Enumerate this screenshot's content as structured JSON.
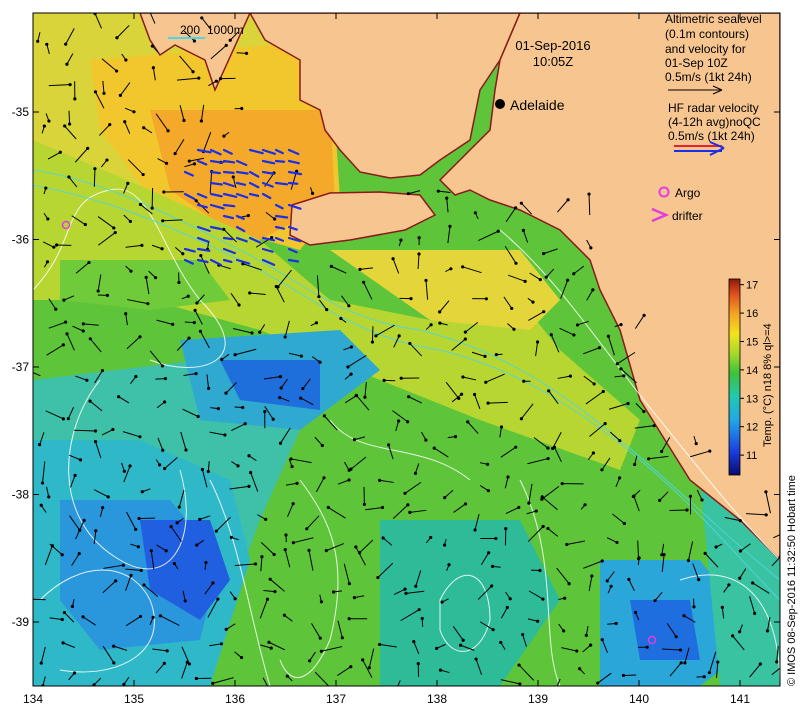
{
  "map": {
    "date": "01-Sep-2016",
    "time": "10:05Z",
    "city": "Adelaide",
    "depth_legend": {
      "a": "200",
      "b": "1000m"
    },
    "lon_ticks": [
      "134",
      "135",
      "136",
      "137",
      "138",
      "139",
      "140",
      "141"
    ],
    "lat_ticks": [
      "-35",
      "-36",
      "-37",
      "-38",
      "-39"
    ],
    "altimetry_legend": [
      "Altimetric sealevel",
      "(0.1m contours)",
      "and velocity for",
      "01-Sep 10Z",
      "0.5m/s (1kt 24h)"
    ],
    "hf_legend": [
      "HF radar velocity",
      "(4-12h avg)noQC",
      "0.5m/s (1kt 24h)"
    ],
    "argo_label": "Argo",
    "drifter_label": "drifter",
    "colorbar": {
      "ticks": [
        "17",
        "16",
        "15",
        "14",
        "13",
        "12",
        "11"
      ],
      "label": "Temp. (°C) n18 8% ql>=4",
      "min": 10.3,
      "max": 17.2
    },
    "credit": "© IMOS 08-Sep-2016 11:32:50 Hobart time",
    "colors": {
      "land": "#F7C690",
      "warm": "#F5A623",
      "green": "#5DC33A",
      "teal": "#30C0B8",
      "blue": "#2D6EE6",
      "hf_red": "#E8202E",
      "hf_blue": "#1B2EE8",
      "argo": "#E23CE0"
    }
  }
}
